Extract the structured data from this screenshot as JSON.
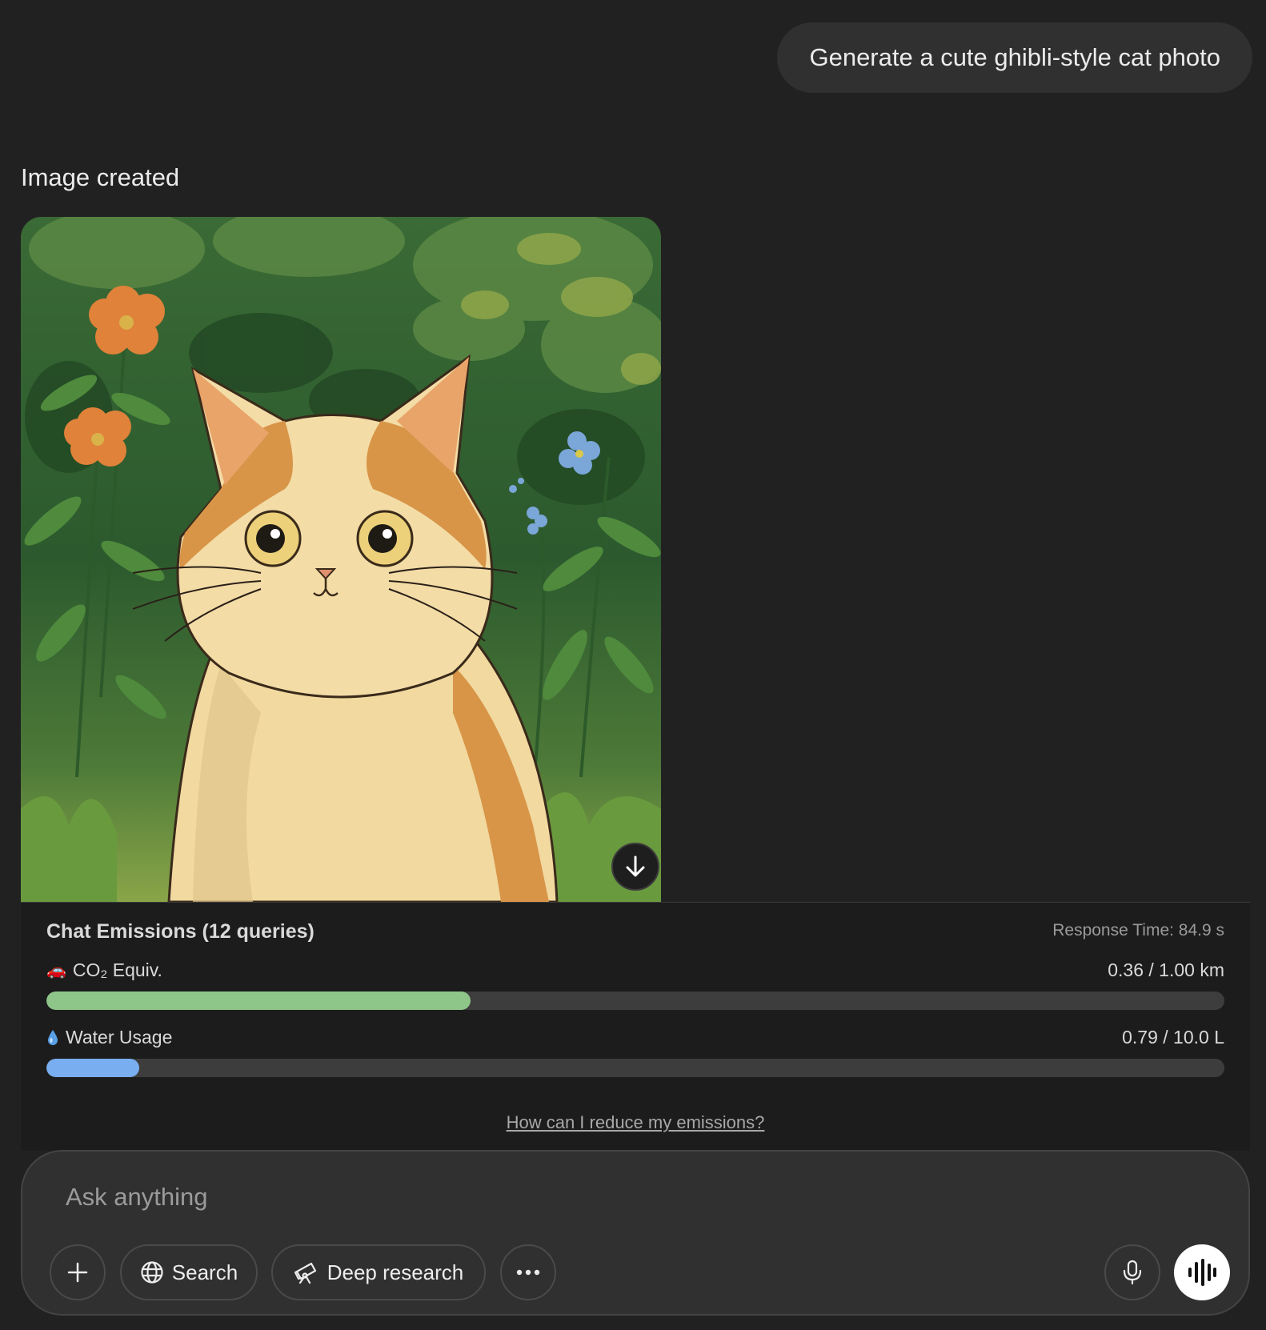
{
  "chat": {
    "user_message": "Generate a cute ghibli-style cat photo",
    "assistant_status": "Image created"
  },
  "emissions": {
    "title": "Chat Emissions (12 queries)",
    "response_time": "Response Time: 84.9 s",
    "metrics": [
      {
        "icon": "car-emoji",
        "emoji": "🚗",
        "label": "CO₂ Equiv.",
        "value": "0.36 / 1.00 km",
        "fraction": 0.36,
        "color": "#8ec68a"
      },
      {
        "icon": "water-drop-icon",
        "label": "Water Usage",
        "value": "0.79 / 10.0 L",
        "fraction": 0.079,
        "color": "#79aef0"
      }
    ],
    "link": "How can I reduce my emissions?"
  },
  "composer": {
    "placeholder": "Ask anything",
    "buttons": {
      "search": "Search",
      "deep_research": "Deep research"
    }
  }
}
